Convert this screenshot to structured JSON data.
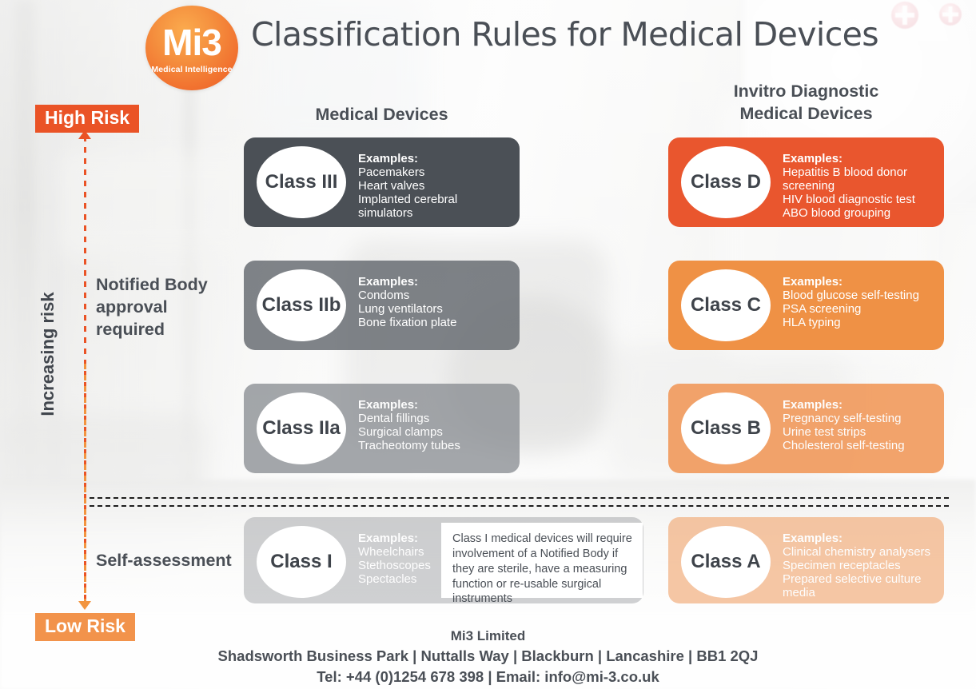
{
  "header": {
    "logo_mark": "Mi3",
    "logo_tagline": "Medical Intelligence",
    "title": "Classification Rules for Medical Devices"
  },
  "columns": {
    "medical_devices": "Medical Devices",
    "ivd_medical_devices": "Invitro Diagnostic\nMedical Devices"
  },
  "risk_axis": {
    "high_label": "High Risk",
    "low_label": "Low Risk",
    "vertical_label": "Increasing risk",
    "high_color": "#ea5326",
    "low_color": "#f2934b"
  },
  "side_labels": {
    "notified_body": "Notified Body\napproval\nrequired",
    "self_assessment": "Self-assessment"
  },
  "examples_title": "Examples:",
  "medical_device_classes": [
    {
      "name": "Class III",
      "color": "#4b5056",
      "examples": [
        "Pacemakers",
        "Heart valves",
        "Implanted cerebral",
        "simulators"
      ]
    },
    {
      "name": "Class IIb",
      "color": "#60656b",
      "examples": [
        "Condoms",
        "Lung ventilators",
        "Bone fixation plate"
      ]
    },
    {
      "name": "Class IIa",
      "color": "#81858a",
      "examples": [
        "Dental fillings",
        "Surgical clamps",
        "Tracheotomy tubes"
      ]
    },
    {
      "name": "Class I",
      "color": "#969a9e",
      "examples": [
        "Wheelchairs",
        "Stethoscopes",
        "Spectacles"
      ]
    }
  ],
  "ivd_classes": [
    {
      "name": "Class D",
      "color": "#e9562e",
      "examples": [
        "Hepatitis B blood donor",
        "screening",
        "HIV blood diagnostic test",
        "ABO blood grouping"
      ]
    },
    {
      "name": "Class C",
      "color": "#ef9145",
      "examples": [
        "Blood glucose self-testing",
        "PSA screening",
        "HLA typing"
      ]
    },
    {
      "name": "Class B",
      "color": "#f09656",
      "examples": [
        "Pregnancy self-testing",
        "Urine test strips",
        "Cholesterol self-testing"
      ]
    },
    {
      "name": "Class A",
      "color": "#f0a56e",
      "examples": [
        "Clinical chemistry analysers",
        "Specimen receptacles",
        "Prepared selective culture",
        "media"
      ]
    }
  ],
  "callout": {
    "text": "Class I medical devices will require involvement of a Notified Body if they are sterile, have a measuring function or re-usable surgical instruments"
  },
  "footer": {
    "company": "Mi3 Limited",
    "address": "Shadsworth Business Park | Nuttalls Way | Blackburn | Lancashire | BB1 2QJ",
    "contact": "Tel:  +44 (0)1254 678 398 | Email: info@mi-3.co.uk"
  }
}
